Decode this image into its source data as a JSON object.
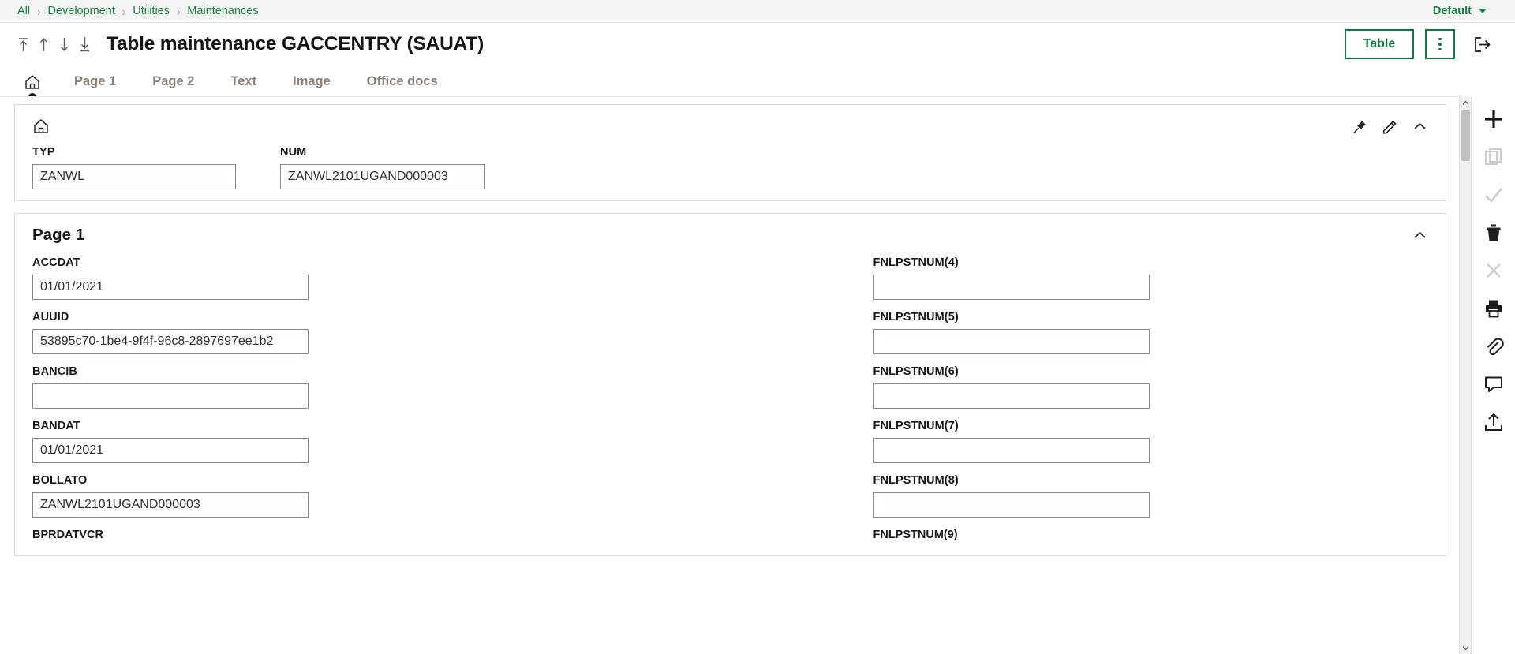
{
  "breadcrumb": {
    "items": [
      {
        "label": "All"
      },
      {
        "label": "Development"
      },
      {
        "label": "Utilities"
      },
      {
        "label": "Maintenances"
      }
    ],
    "separator": "›"
  },
  "profile": {
    "label": "Default",
    "icon": "chevron-down-icon"
  },
  "header": {
    "title": "Table maintenance GACCENTRY (SAUAT)",
    "nav_icons": [
      "first-record-icon",
      "previous-record-icon",
      "next-record-icon",
      "last-record-icon"
    ],
    "table_button": "Table",
    "kebab_icon": "more-options-icon",
    "exit_icon": "exit-icon"
  },
  "tabs": [
    {
      "label": "",
      "icon": "home-icon",
      "active": true
    },
    {
      "label": "Page 1",
      "active": false
    },
    {
      "label": "Page 2",
      "active": false
    },
    {
      "label": "Text",
      "active": false
    },
    {
      "label": "Image",
      "active": false
    },
    {
      "label": "Office docs",
      "active": false
    }
  ],
  "top_card": {
    "home_icon": "home-icon",
    "actions": [
      "pin-icon",
      "pencil-icon",
      "chevron-up-icon"
    ],
    "fields": [
      {
        "label": "TYP",
        "value": "ZANWL"
      },
      {
        "label": "NUM",
        "value": "ZANWL2101UGAND000003"
      }
    ]
  },
  "page1_card": {
    "title": "Page 1",
    "collapse_icon": "chevron-up-icon",
    "left_fields": [
      {
        "label": "ACCDAT",
        "value": "01/01/2021"
      },
      {
        "label": "AUUID",
        "value": "53895c70-1be4-9f4f-96c8-2897697ee1b2"
      },
      {
        "label": "BANCIB",
        "value": ""
      },
      {
        "label": "BANDAT",
        "value": "01/01/2021"
      },
      {
        "label": "BOLLATO",
        "value": "ZANWL2101UGAND000003"
      }
    ],
    "right_fields": [
      {
        "label": "FNLPSTNUM(4)",
        "value": ""
      },
      {
        "label": "FNLPSTNUM(5)",
        "value": ""
      },
      {
        "label": "FNLPSTNUM(6)",
        "value": ""
      },
      {
        "label": "FNLPSTNUM(7)",
        "value": ""
      },
      {
        "label": "FNLPSTNUM(8)",
        "value": ""
      }
    ],
    "cut_labels": {
      "left": "BPRDATVCR",
      "right": "FNLPSTNUM(9)"
    }
  },
  "right_toolbar": [
    {
      "icon": "plus-icon",
      "enabled": true
    },
    {
      "icon": "duplicate-icon",
      "enabled": false
    },
    {
      "icon": "check-icon",
      "enabled": false
    },
    {
      "icon": "trash-icon",
      "enabled": true
    },
    {
      "icon": "cancel-icon",
      "enabled": false
    },
    {
      "icon": "print-icon",
      "enabled": true
    },
    {
      "icon": "attachment-icon",
      "enabled": true
    },
    {
      "icon": "comment-icon",
      "enabled": true
    },
    {
      "icon": "export-icon",
      "enabled": true
    }
  ],
  "scrollbar": {
    "up_icon": "scroll-up-icon",
    "down_icon": "scroll-down-icon"
  },
  "colors": {
    "accent_green": "#0f7a3d",
    "link_green": "#15803d",
    "border": "#7b8b94"
  }
}
